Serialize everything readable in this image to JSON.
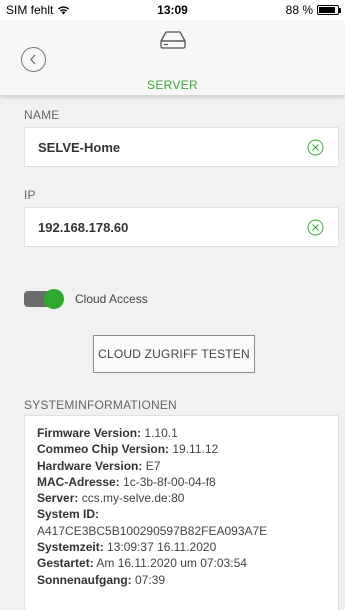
{
  "status_bar": {
    "carrier": "SIM fehlt",
    "time": "13:09",
    "battery": "88 %",
    "battery_level": 0.88
  },
  "header": {
    "title": "SERVER",
    "accent_color": "#3aa935"
  },
  "name_section": {
    "label": "NAME",
    "value": "SELVE-Home"
  },
  "ip_section": {
    "label": "IP",
    "value": "192.168.178.60"
  },
  "cloud": {
    "toggle_on": true,
    "label": "Cloud Access",
    "toggle_color": "#2fa82d",
    "test_button_label": "CLOUD ZUGRIFF TESTEN"
  },
  "system_info": {
    "heading": "SYSTEMINFORMATIONEN",
    "lines": [
      {
        "key": "Firmware Version:",
        "value": " 1.10.1"
      },
      {
        "key": "Commeo Chip Version:",
        "value": " 19.11.12"
      },
      {
        "key": "Hardware Version:",
        "value": " E7"
      },
      {
        "key": "MAC-Adresse:",
        "value": " 1c-3b-8f-00-04-f8"
      },
      {
        "key": "Server:",
        "value": " ccs.my-selve.de:80"
      },
      {
        "key": "System ID:",
        "value": ""
      },
      {
        "key": "",
        "value": "A417CE3BC5B100290597B82FEA093A7E"
      },
      {
        "key": "Systemzeit:",
        "value": " 13:09:37 16.11.2020"
      },
      {
        "key": "Gestartet:",
        "value": " Am 16.11.2020 um 07:03:54"
      },
      {
        "key": "Sonnenaufgang:",
        "value": " 07:39"
      }
    ]
  }
}
